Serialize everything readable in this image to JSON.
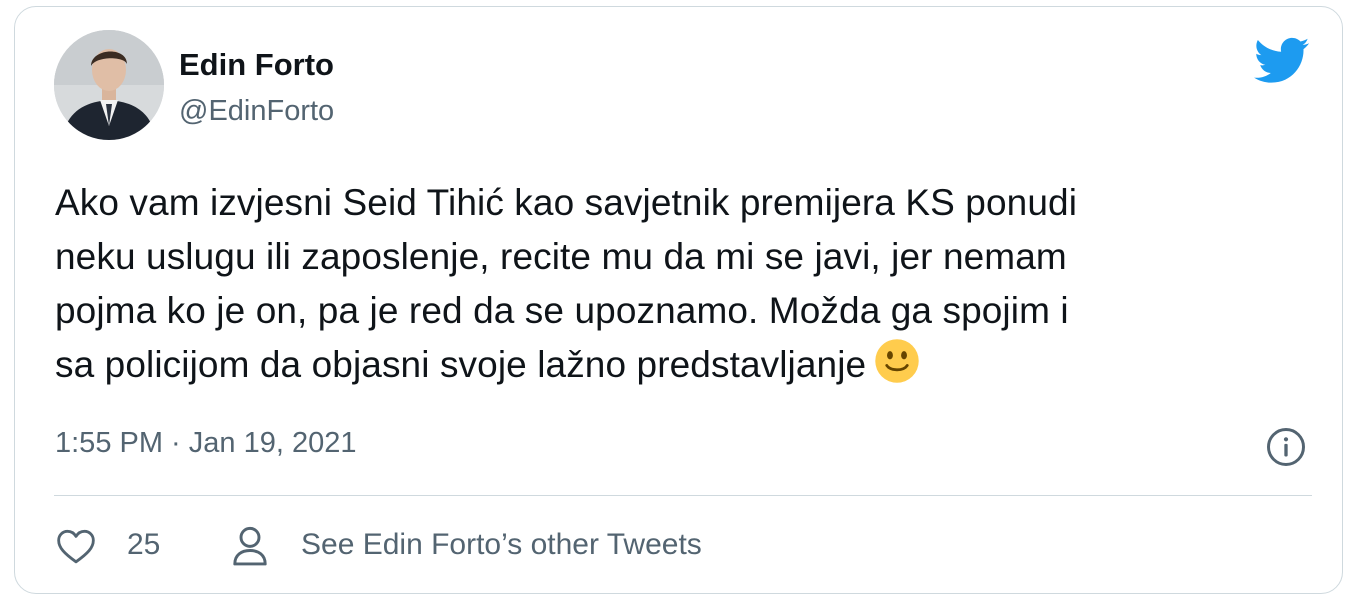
{
  "author": {
    "display_name": "Edin Forto",
    "handle": "@EdinForto",
    "avatar": "avatar-photo"
  },
  "tweet": {
    "lines": [
      "Ako vam izvjesni Seid Tihić kao savjetnik premijera KS ponudi",
      "neku uslugu ili zaposlenje, recite mu da mi se javi, jer nemam",
      "pojma ko je on, pa je red da se upoznamo. Možda ga spojim i",
      "sa policijom da objasni svoje lažno predstavljanje"
    ],
    "emoji": "slightly-smiling-face",
    "timestamp": "1:55 PM · Jan 19, 2021"
  },
  "actions": {
    "like_icon": "heart-icon",
    "like_count": "25",
    "profile_icon": "person-icon",
    "see_more_label": "See Edin Forto’s other Tweets"
  },
  "icons": {
    "brand": "twitter-bird-icon",
    "info": "info-icon"
  },
  "colors": {
    "brand": "#1d9bf0",
    "text_primary": "#0f1419",
    "text_secondary": "#536471",
    "border": "#cfd9de"
  }
}
